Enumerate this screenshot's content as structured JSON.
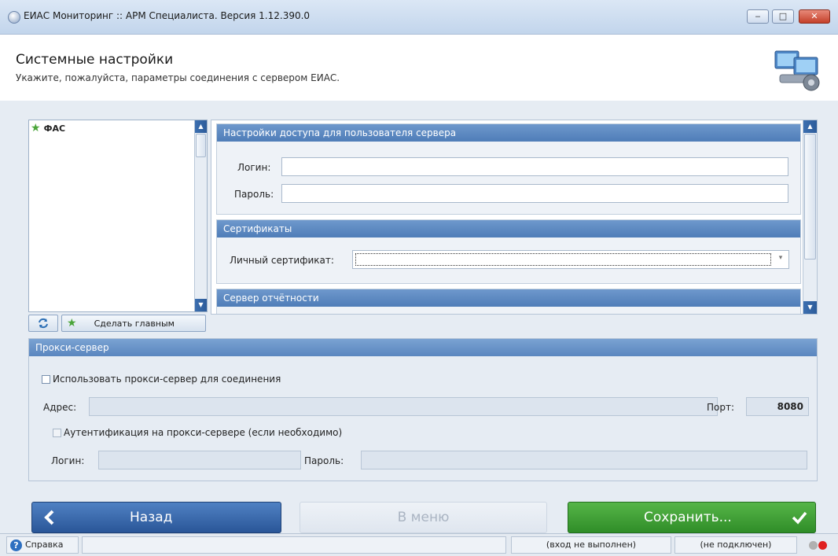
{
  "window": {
    "title": "ЕИАС Мониторинг :: АРМ Специалиста. Версия 1.12.390.0",
    "minimize": "‒",
    "maximize": "□",
    "close": "✕"
  },
  "header": {
    "title": "Системные настройки",
    "subtitle": "Укажите, пожалуйста, параметры соединения с сервером ЕИАС."
  },
  "tree": {
    "items": [
      {
        "label": "ФАС",
        "icon": "star-icon"
      }
    ],
    "refresh_icon": "refresh-icon",
    "make_main_label": "Сделать главным"
  },
  "access_panel": {
    "title": "Настройки доступа для пользователя сервера",
    "login_label": "Логин:",
    "login_value": "",
    "password_label": "Пароль:",
    "password_value": ""
  },
  "certificates_panel": {
    "title": "Сертификаты",
    "personal_cert_label": "Личный сертификат:",
    "personal_cert_value": ""
  },
  "report_server_panel": {
    "title": "Сервер отчётности"
  },
  "proxy": {
    "title": "Прокси-сервер",
    "use_proxy_label": "Использовать прокси-сервер для соединения",
    "use_proxy_checked": false,
    "address_label": "Адрес:",
    "address_value": "",
    "port_label": "Порт:",
    "port_value": "8080",
    "auth_label": "Аутентификация на прокси-сервере (если необходимо)",
    "auth_checked": false,
    "login_label": "Логин:",
    "login_value": "",
    "password_label": "Пароль:",
    "password_value": ""
  },
  "buttons": {
    "back": "Назад",
    "menu": "В меню",
    "save": "Сохранить..."
  },
  "statusbar": {
    "help": "Справка",
    "login_status": "(вход не выполнен)",
    "connection_status": "(не подключен)"
  },
  "colors": {
    "accent_blue": "#4f7db8",
    "save_green": "#2f8d28",
    "status_gray": "#b0b0b0",
    "status_red": "#e02020"
  }
}
